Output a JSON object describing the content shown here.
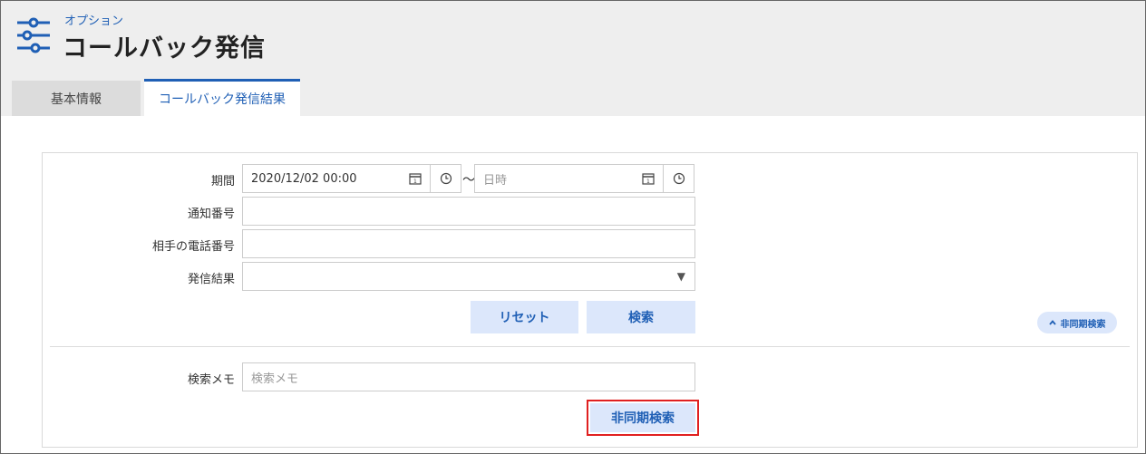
{
  "header": {
    "breadcrumb": "オプション",
    "title": "コールバック発信",
    "icon": "settings-sliders-icon"
  },
  "tabs": [
    {
      "label": "基本情報",
      "active": false
    },
    {
      "label": "コールバック発信結果",
      "active": true
    }
  ],
  "form": {
    "period": {
      "label": "期間",
      "start_value": "2020/12/02 00:00",
      "separator": "～",
      "end_placeholder": "日時"
    },
    "notice_number": {
      "label": "通知番号",
      "value": ""
    },
    "phone_number": {
      "label": "相手の電話番号",
      "value": ""
    },
    "result": {
      "label": "発信結果",
      "value": ""
    },
    "reset_label": "リセット",
    "search_label": "検索",
    "async_toggle_label": "非同期検索",
    "memo": {
      "label": "検索メモ",
      "placeholder": "検索メモ"
    },
    "async_search_label": "非同期検索"
  },
  "colors": {
    "accent": "#1f5fb5",
    "button_bg": "#dce7fb",
    "highlight": "#e02020"
  }
}
